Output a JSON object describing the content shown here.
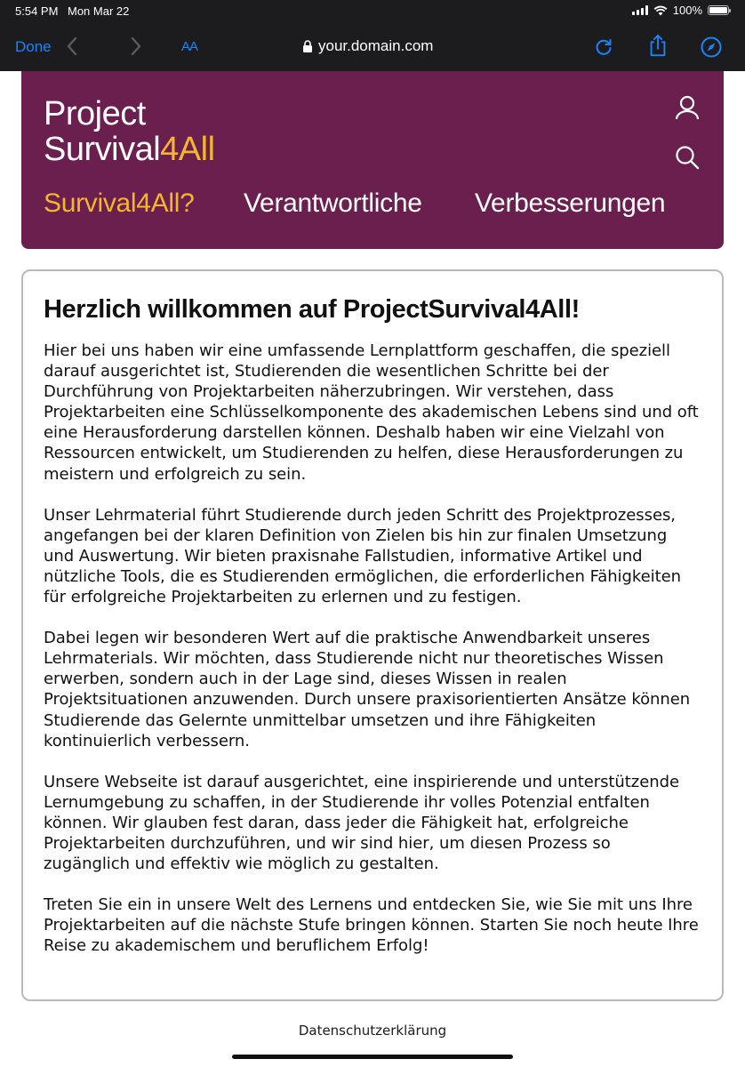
{
  "status_bar": {
    "time": "5:54 PM",
    "date": "Mon Mar 22",
    "battery": "100%"
  },
  "browser": {
    "done_label": "Done",
    "text_size_label": "AA",
    "url": "your.domain.com"
  },
  "site": {
    "logo_line1": "Project",
    "logo_line2_main": "Survival",
    "logo_line2_accent": "4All",
    "accent_color": "#f5b52e",
    "header_color": "#6a1f4f",
    "nav": [
      {
        "label": "Survival4All?",
        "active": true
      },
      {
        "label": "Verantwortliche",
        "active": false
      },
      {
        "label": "Verbesserungen",
        "active": false
      }
    ]
  },
  "content": {
    "heading": "Herzlich willkommen auf ProjectSurvival4All!",
    "paragraphs": [
      "Hier bei uns haben wir eine umfassende Lernplattform geschaffen, die speziell darauf ausgerichtet ist, Studierenden die wesentlichen Schritte bei der Durchführung von Projektarbeiten näherzubringen. Wir verstehen, dass Projektarbeiten eine Schlüsselkomponente des akademischen Lebens sind und oft eine Herausforderung darstellen können. Deshalb haben wir eine Vielzahl von Ressourcen entwickelt, um Studierenden zu helfen, diese Herausforderungen zu meistern und erfolgreich zu sein.",
      "Unser Lehrmaterial führt Studierende durch jeden Schritt des Projektprozesses, angefangen bei der klaren Definition von Zielen bis hin zur finalen Umsetzung und Auswertung. Wir bieten praxisnahe Fallstudien, informative Artikel und nützliche Tools, die es Studierenden ermöglichen, die erforderlichen Fähigkeiten für erfolgreiche Projektarbeiten zu erlernen und zu festigen.",
      "Dabei legen wir besonderen Wert auf die praktische Anwendbarkeit unseres Lehrmaterials. Wir möchten, dass Studierende nicht nur theoretisches Wissen erwerben, sondern auch in der Lage sind, dieses Wissen in realen Projektsituationen anzuwenden. Durch unsere praxisorientierten Ansätze können Studierende das Gelernte unmittelbar umsetzen und ihre Fähigkeiten kontinuierlich verbessern.",
      "Unsere Webseite ist darauf ausgerichtet, eine inspirierende und unterstützende Lernumgebung zu schaffen, in der Studierende ihr volles Potenzial entfalten können. Wir glauben fest daran, dass jeder die Fähigkeit hat, erfolgreiche Projektarbeiten durchzuführen, und wir sind hier, um diesen Prozess so zugänglich und effektiv wie möglich zu gestalten.",
      "Treten Sie ein in unsere Welt des Lernens und entdecken Sie, wie Sie mit uns Ihre Projektarbeiten auf die nächste Stufe bringen können. Starten Sie noch heute Ihre Reise zu akademischem und beruflichem Erfolg!"
    ]
  },
  "footer": {
    "privacy_link": "Datenschutzerklärung"
  },
  "icons": {
    "back": "chevron-left-icon",
    "forward": "chevron-right-icon",
    "lock": "lock-icon",
    "reload": "reload-icon",
    "share": "share-icon",
    "compass": "compass-icon",
    "user": "user-icon",
    "search": "search-icon"
  }
}
